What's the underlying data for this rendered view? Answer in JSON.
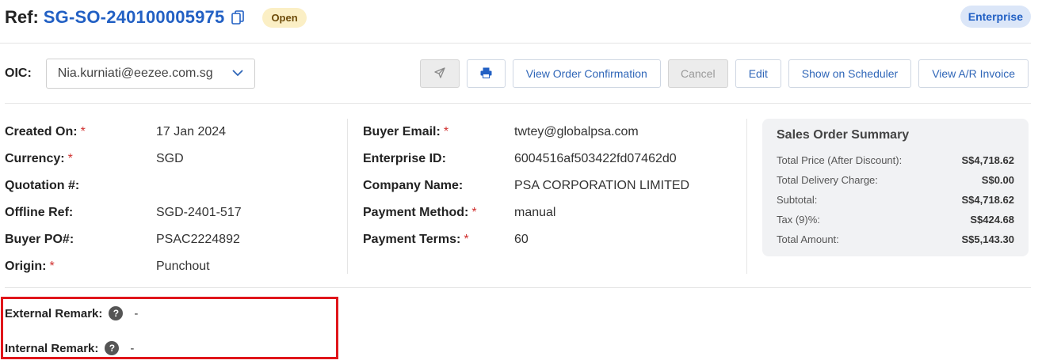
{
  "header": {
    "ref_label": "Ref:",
    "ref_value": "SG-SO-240100005975",
    "status": "Open",
    "tier_badge": "Enterprise"
  },
  "oic": {
    "label": "OIC:",
    "selected": "Nia.kurniati@eezee.com.sg"
  },
  "toolbar": {
    "send_icon": "send-icon",
    "print_icon": "print-icon",
    "view_order_confirmation": "View Order Confirmation",
    "cancel": "Cancel",
    "edit": "Edit",
    "show_on_scheduler": "Show on Scheduler",
    "view_ar_invoice": "View A/R Invoice"
  },
  "details_left": [
    {
      "label": "Created On:",
      "required": "*",
      "value": "17 Jan 2024"
    },
    {
      "label": "Currency:",
      "required": "*",
      "value": "SGD"
    },
    {
      "label": "Quotation #:",
      "required": "",
      "value": ""
    },
    {
      "label": "Offline Ref:",
      "required": "",
      "value": "SGD-2401-517"
    },
    {
      "label": "Buyer PO#:",
      "required": "",
      "value": "PSAC2224892"
    },
    {
      "label": "Origin:",
      "required": "*",
      "value": "Punchout"
    }
  ],
  "details_right": [
    {
      "label": "Buyer Email:",
      "required": "*",
      "value": "twtey@globalpsa.com"
    },
    {
      "label": "Enterprise ID:",
      "required": "",
      "value": "6004516af503422fd07462d0"
    },
    {
      "label": "Company Name:",
      "required": "",
      "value": "PSA CORPORATION LIMITED"
    },
    {
      "label": "Payment Method:",
      "required": "*",
      "value": "manual"
    },
    {
      "label": "Payment Terms:",
      "required": "*",
      "value": "60"
    }
  ],
  "summary": {
    "title": "Sales Order Summary",
    "rows": [
      {
        "label": "Total Price (After Discount):",
        "value": "S$4,718.62"
      },
      {
        "label": "Total Delivery Charge:",
        "value": "S$0.00"
      },
      {
        "label": "Subtotal:",
        "value": "S$4,718.62"
      },
      {
        "label": "Tax (9)%:",
        "value": "S$424.68"
      },
      {
        "label": "Total Amount:",
        "value": "S$5,143.30"
      }
    ]
  },
  "remarks": {
    "external_label": "External Remark:",
    "external_value": "-",
    "internal_label": "Internal Remark:",
    "internal_value": "-",
    "help_glyph": "?"
  }
}
